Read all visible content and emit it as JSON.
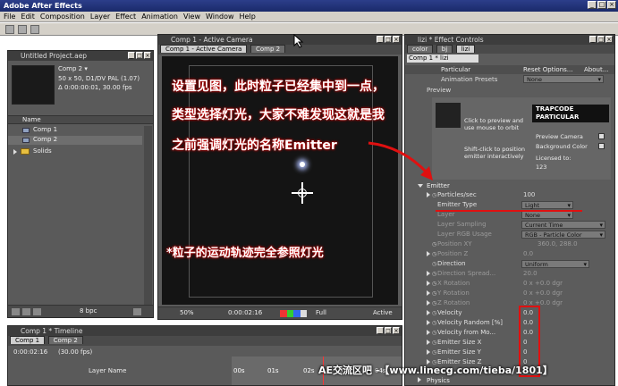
{
  "app": {
    "title": "Adobe After Effects",
    "menus": [
      "File",
      "Edit",
      "Composition",
      "Layer",
      "Effect",
      "Animation",
      "View",
      "Window",
      "Help"
    ]
  },
  "project": {
    "title": "Untitled Project.aep",
    "comp_name": "Comp 2 ▾",
    "comp_info_1": "50 x 50, D1/DV PAL (1.07)",
    "comp_info_2": "Δ 0:00:00:01, 30.00 fps",
    "col_name": "Name",
    "items": [
      "Comp 1",
      "Comp 2",
      "Solids"
    ],
    "bpc": "8 bpc"
  },
  "comp_viewer": {
    "title": "Comp 1 - Active Camera",
    "tabs": [
      "Comp 1 - Active Camera",
      "Comp 2"
    ],
    "zoom": "50%",
    "timecode": "0:00:02:16",
    "resolution": "Full",
    "view": "Active"
  },
  "timeline": {
    "title": "Comp 1 * Timeline",
    "tabs": [
      "Comp 1",
      "Comp 2"
    ],
    "timecode": "0:00:02:16",
    "fps": "(30.00 fps)",
    "layer_name_col": "Layer Name",
    "ruler": [
      "00s",
      "01s",
      "02s",
      "03s",
      "04s"
    ]
  },
  "effect_controls": {
    "title": "lizi * Effect Controls",
    "tabs": [
      "color",
      "bj",
      "lizi"
    ],
    "header": "Comp 1 * lizi",
    "fx_name": "Particular",
    "reset_options": "Reset Options...",
    "about": "About...",
    "animation_presets_label": "Animation Presets",
    "animation_presets_value": "None",
    "preview_label": "Preview",
    "click_preview": "Click to preview and use mouse to orbit",
    "shift_click": "Shift-click to position emitter interactively",
    "logo_line1": "TRAPCODE",
    "logo_line2": "PARTICULAR",
    "preview_camera": "Preview Camera",
    "background_color": "Background Color",
    "licensed_to": "Licensed to:",
    "license_num": "123",
    "emitter_section": "Emitter",
    "rows": [
      {
        "label": "Particles/sec",
        "value": "100"
      },
      {
        "label": "Emitter Type",
        "value": "Light"
      },
      {
        "label": "Layer",
        "value": "None"
      },
      {
        "label": "Layer Sampling",
        "value": "Current Time"
      },
      {
        "label": "Layer RGB Usage",
        "value": "RGB - Particle Color"
      },
      {
        "label": "Position XY",
        "value": "360.0, 288.0"
      },
      {
        "label": "Position Z",
        "value": "0.0"
      },
      {
        "label": "Direction",
        "value": "Uniform"
      },
      {
        "label": "Direction Spread...",
        "value": "20.0"
      },
      {
        "label": "X Rotation",
        "value": "0 x +0.0 dgr"
      },
      {
        "label": "Y Rotation",
        "value": "0 x +0.0 dgr"
      },
      {
        "label": "Z Rotation",
        "value": "0 x +0.0 dgr"
      },
      {
        "label": "Velocity",
        "value": "0.0"
      },
      {
        "label": "Velocity Random [%]",
        "value": "0.0"
      },
      {
        "label": "Velocity from Mo...",
        "value": "0.0"
      },
      {
        "label": "Emitter Size X",
        "value": "0"
      },
      {
        "label": "Emitter Size Y",
        "value": "0"
      },
      {
        "label": "Emitter Size Z",
        "value": "0"
      }
    ],
    "physics": "Physics"
  },
  "annotations": {
    "line1": "设置见图，此时粒子已经集中到一点，",
    "line2": "类型选择灯光，大家不难发现这就是我",
    "line3": "之前强调灯光的名称Emitter",
    "note": "*粒子的运动轨迹完全参照灯光",
    "watermark": "AE交流区吧 -【www.linecg.com/tieba/1801】"
  },
  "colors": {
    "annotation_glow": "#cc0000",
    "highlight_red": "#e01010",
    "title_bar": "#1a2a6a"
  }
}
